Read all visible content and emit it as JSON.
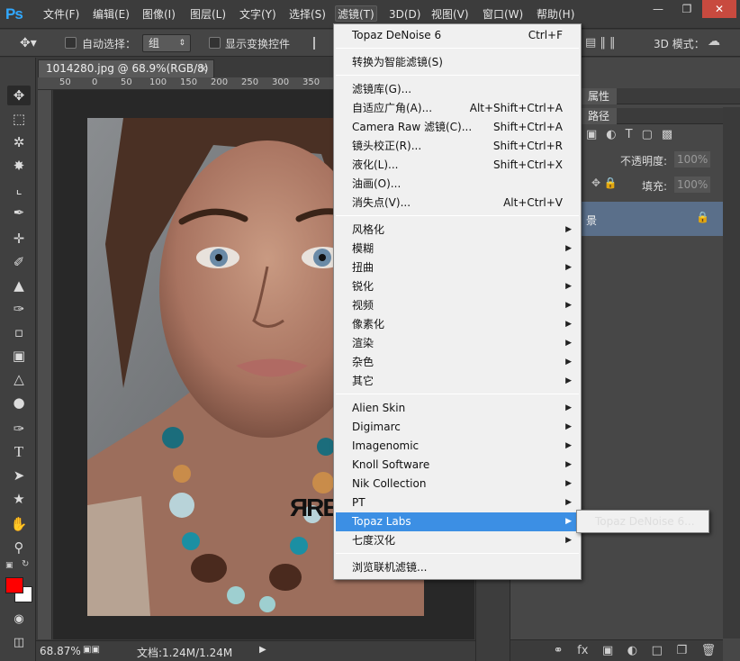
{
  "app": {
    "logo": "Ps"
  },
  "menubar": {
    "items": [
      "文件(F)",
      "编辑(E)",
      "图像(I)",
      "图层(L)",
      "文字(Y)",
      "选择(S)",
      "滤镜(T)",
      "3D(D)",
      "视图(V)",
      "窗口(W)",
      "帮助(H)"
    ]
  },
  "options_bar": {
    "auto_select_label": "自动选择：",
    "auto_select_value": "组",
    "show_transform_label": "显示变换控件",
    "mode_3d_label": "3D 模式："
  },
  "document": {
    "tab_title": "1014280.jpg @ 68.9%(RGB/8)",
    "close_glyph": "×",
    "ruler_labels": [
      "50",
      "0",
      "50",
      "100",
      "150",
      "200",
      "250",
      "300",
      "350"
    ],
    "watermark": "ЯRE"
  },
  "status": {
    "zoom": "68.87%",
    "doc_info": "文档:1.24M/1.24M"
  },
  "panels": {
    "properties_tab": "属性",
    "paths_tab": "路径",
    "opacity_label": "不透明度:",
    "opacity_value": "100%",
    "fill_label": "填充:",
    "fill_value": "100%",
    "layer_name": "景"
  },
  "filter_menu": {
    "last_filter": {
      "label": "Topaz DeNoise 6",
      "shortcut": "Ctrl+F"
    },
    "smart": "转换为智能滤镜(S)",
    "group1": [
      {
        "label": "滤镜库(G)...",
        "shortcut": ""
      },
      {
        "label": "自适应广角(A)...",
        "shortcut": "Alt+Shift+Ctrl+A"
      },
      {
        "label": "Camera Raw 滤镜(C)...",
        "shortcut": "Shift+Ctrl+A"
      },
      {
        "label": "镜头校正(R)...",
        "shortcut": "Shift+Ctrl+R"
      },
      {
        "label": "液化(L)...",
        "shortcut": "Shift+Ctrl+X"
      },
      {
        "label": "油画(O)...",
        "shortcut": ""
      },
      {
        "label": "消失点(V)...",
        "shortcut": "Alt+Ctrl+V"
      }
    ],
    "group2": [
      "风格化",
      "模糊",
      "扭曲",
      "锐化",
      "视频",
      "像素化",
      "渲染",
      "杂色",
      "其它"
    ],
    "group3": [
      "Alien Skin",
      "Digimarc",
      "Imagenomic",
      "Knoll Software",
      "Nik Collection",
      "PT",
      "Topaz Labs",
      "七度汉化"
    ],
    "browse": "浏览联机滤镜...",
    "highlighted": "Topaz Labs",
    "submenu_item": "Topaz DeNoise 6..."
  },
  "colors": {
    "highlight": "#3c8fe4",
    "foreground_swatch": "#ff0000",
    "background_swatch": "#ffffff",
    "ps_blue": "#31a8ff"
  }
}
